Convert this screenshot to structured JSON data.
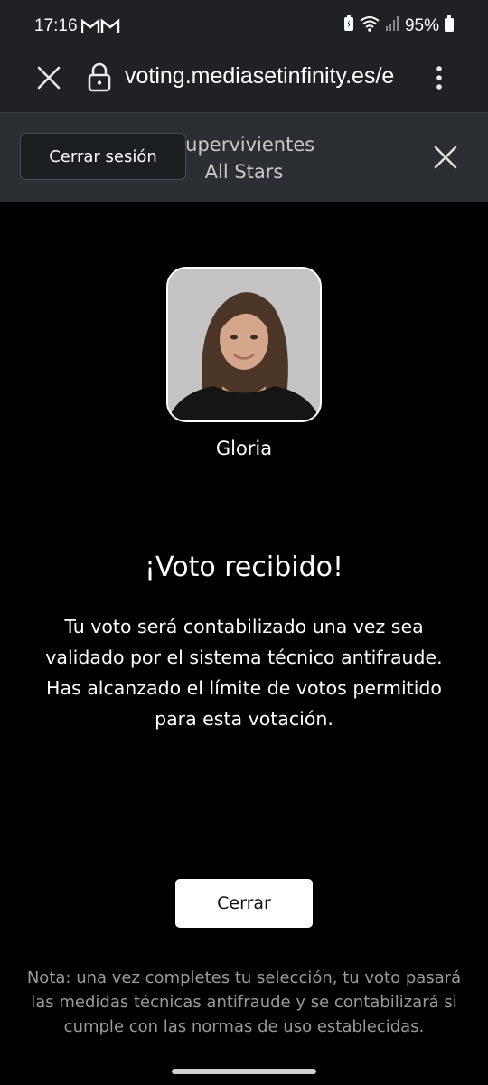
{
  "status_bar": {
    "time": "17:16",
    "notification_icons": "M M",
    "battery_percent": "95%"
  },
  "browser": {
    "url": "voting.mediasetinfinity.es/e"
  },
  "header": {
    "logout_label": "Cerrar sesión",
    "title_line1": "Supervivientes",
    "title_line2": "All Stars"
  },
  "candidate": {
    "name": "Gloria"
  },
  "confirmation": {
    "title": "¡Voto recibido!",
    "message": "Tu voto será contabilizado una vez sea validado por el sistema técnico antifraude. Has alcanzado el límite de votos permitido para esta votación."
  },
  "close_button_label": "Cerrar",
  "footnote": "Nota: una vez completes tu selección, tu voto pasará las medidas técnicas antifraude y se contabilizará si cumple con las normas de uso establecidas.",
  "colors": {
    "background": "#000000",
    "chrome": "#202124",
    "header": "#2b2f33"
  }
}
